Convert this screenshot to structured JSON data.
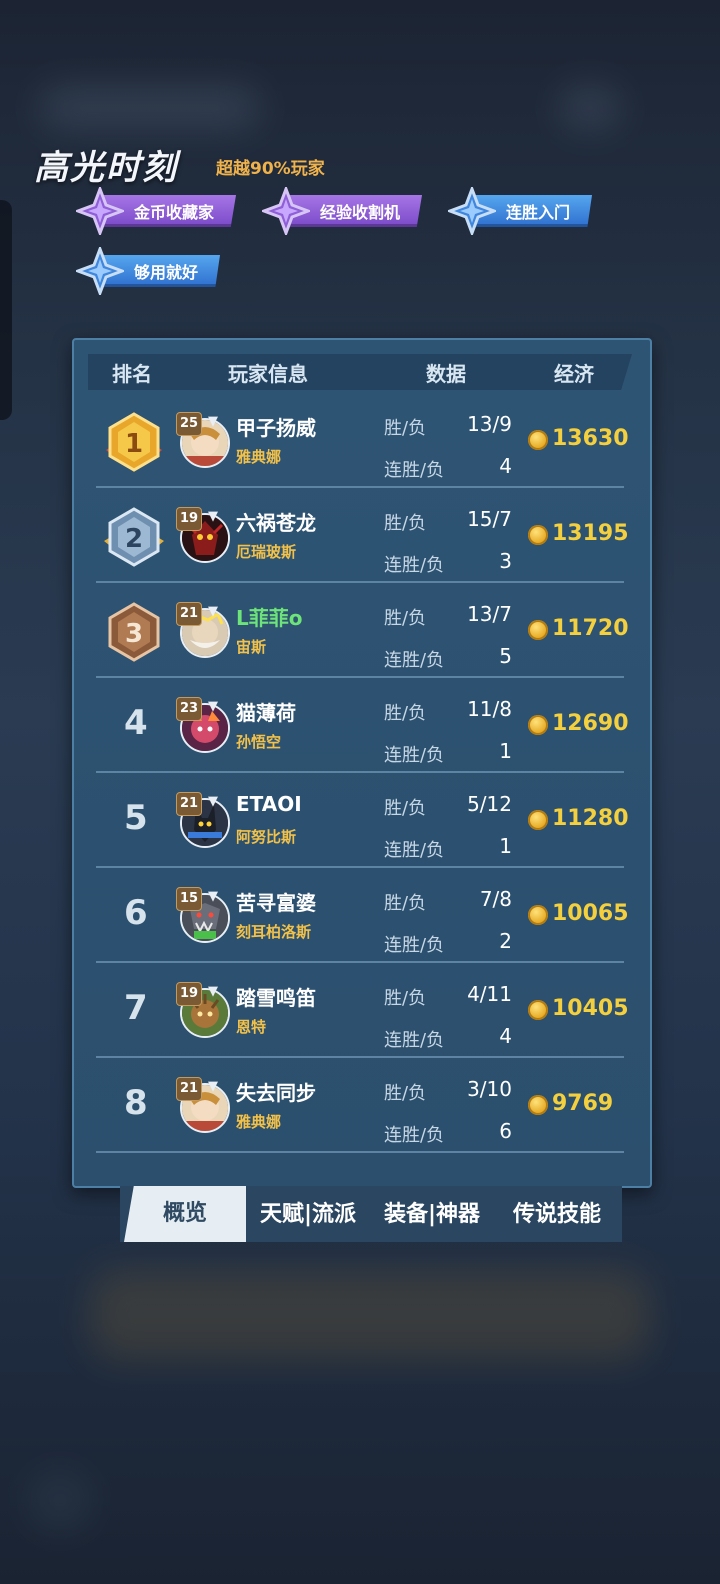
{
  "highlight": {
    "title": "高光时刻",
    "subtitle": "超越90%玩家",
    "badges": [
      {
        "label": "金币收藏家",
        "color": "purple"
      },
      {
        "label": "经验收割机",
        "color": "purple"
      },
      {
        "label": "连胜入门",
        "color": "blue"
      },
      {
        "label": "够用就好",
        "color": "blue"
      }
    ]
  },
  "table": {
    "headers": {
      "rank": "排名",
      "player": "玩家信息",
      "data": "数据",
      "economy": "经济"
    },
    "win_loss_label": "胜/负",
    "streak_label": "连胜/负",
    "rows": [
      {
        "rank": "1",
        "level": "25",
        "name": "甲子扬威",
        "hero": "雅典娜",
        "wl": "13/9",
        "streak": "4",
        "economy": "13630"
      },
      {
        "rank": "2",
        "level": "19",
        "name": "六祸苍龙",
        "hero": "厄瑞玻斯",
        "wl": "15/7",
        "streak": "3",
        "economy": "13195"
      },
      {
        "rank": "3",
        "level": "21",
        "name": "L菲菲o",
        "hero": "宙斯",
        "wl": "13/7",
        "streak": "5",
        "economy": "11720"
      },
      {
        "rank": "4",
        "level": "23",
        "name": "猫薄荷",
        "hero": "孙悟空",
        "wl": "11/8",
        "streak": "1",
        "economy": "12690"
      },
      {
        "rank": "5",
        "level": "21",
        "name": "ETAOI",
        "hero": "阿努比斯",
        "wl": "5/12",
        "streak": "1",
        "economy": "11280"
      },
      {
        "rank": "6",
        "level": "15",
        "name": "苦寻富婆",
        "hero": "刻耳柏洛斯",
        "wl": "7/8",
        "streak": "2",
        "economy": "10065"
      },
      {
        "rank": "7",
        "level": "19",
        "name": "踏雪鸣笛",
        "hero": "恩特",
        "wl": "4/11",
        "streak": "4",
        "economy": "10405"
      },
      {
        "rank": "8",
        "level": "21",
        "name": "失去同步",
        "hero": "雅典娜",
        "wl": "3/10",
        "streak": "6",
        "economy": "9769"
      }
    ]
  },
  "tabs": [
    {
      "label": "概览",
      "active": true
    },
    {
      "label": "天赋|流派",
      "active": false
    },
    {
      "label": "装备|神器",
      "active": false
    },
    {
      "label": "传说技能",
      "active": false
    }
  ],
  "colors": {
    "gold": "#f4cf3e",
    "highlight_green": "#6ee37a",
    "hero_name": "#f2c14a",
    "panel": "#2e5474"
  }
}
